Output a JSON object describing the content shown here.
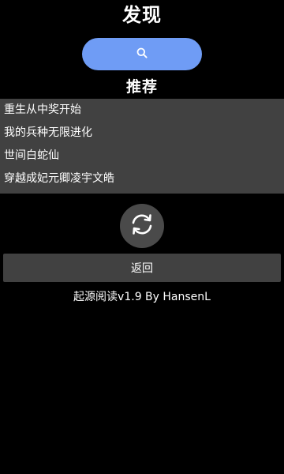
{
  "header": {
    "title": "发现"
  },
  "search": {
    "icon": "search-icon"
  },
  "recommend": {
    "title": "推荐",
    "items": [
      "重生从中奖开始",
      "我的兵种无限进化",
      "世间白蛇仙",
      "穿越成妃元卿凌宇文皓"
    ]
  },
  "refresh": {
    "icon": "refresh-icon"
  },
  "actions": {
    "back_label": "返回"
  },
  "footer": {
    "version_text": "起源阅读v1.9  By HansenL"
  },
  "colors": {
    "background": "#000000",
    "accent": "#6f9cf5",
    "panel": "#414141",
    "refresh_bg": "#4a4a4a",
    "text": "#ffffff"
  }
}
